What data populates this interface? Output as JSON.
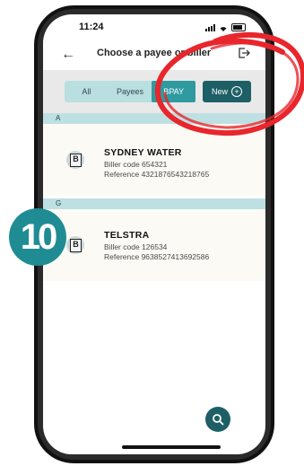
{
  "status": {
    "time": "11:24"
  },
  "header": {
    "title": "Choose a payee or biller"
  },
  "filters": {
    "tabs": [
      {
        "label": "All"
      },
      {
        "label": "Payees"
      },
      {
        "label": "BPAY"
      }
    ],
    "active": "BPAY",
    "new_label": "New"
  },
  "sections": [
    {
      "letter": "A",
      "items": [
        {
          "name": "SYDNEY WATER",
          "biller_code": "Biller code 654321",
          "reference": "Reference 4321876543218765"
        }
      ]
    },
    {
      "letter": "G",
      "items": [
        {
          "name": "TELSTRA",
          "biller_code": "Biller code 126534",
          "reference": "Reference 9638527413692586"
        }
      ]
    }
  ],
  "step_badge": "10",
  "colors": {
    "accent": "#1e5f66",
    "segment": "#b9dfe0",
    "active_tab": "#2f9aa0",
    "highlight": "#e8262c"
  },
  "icons": [
    "back-arrow-icon",
    "exit-icon",
    "plus-circle-icon",
    "bpay-logo-icon",
    "search-icon"
  ]
}
